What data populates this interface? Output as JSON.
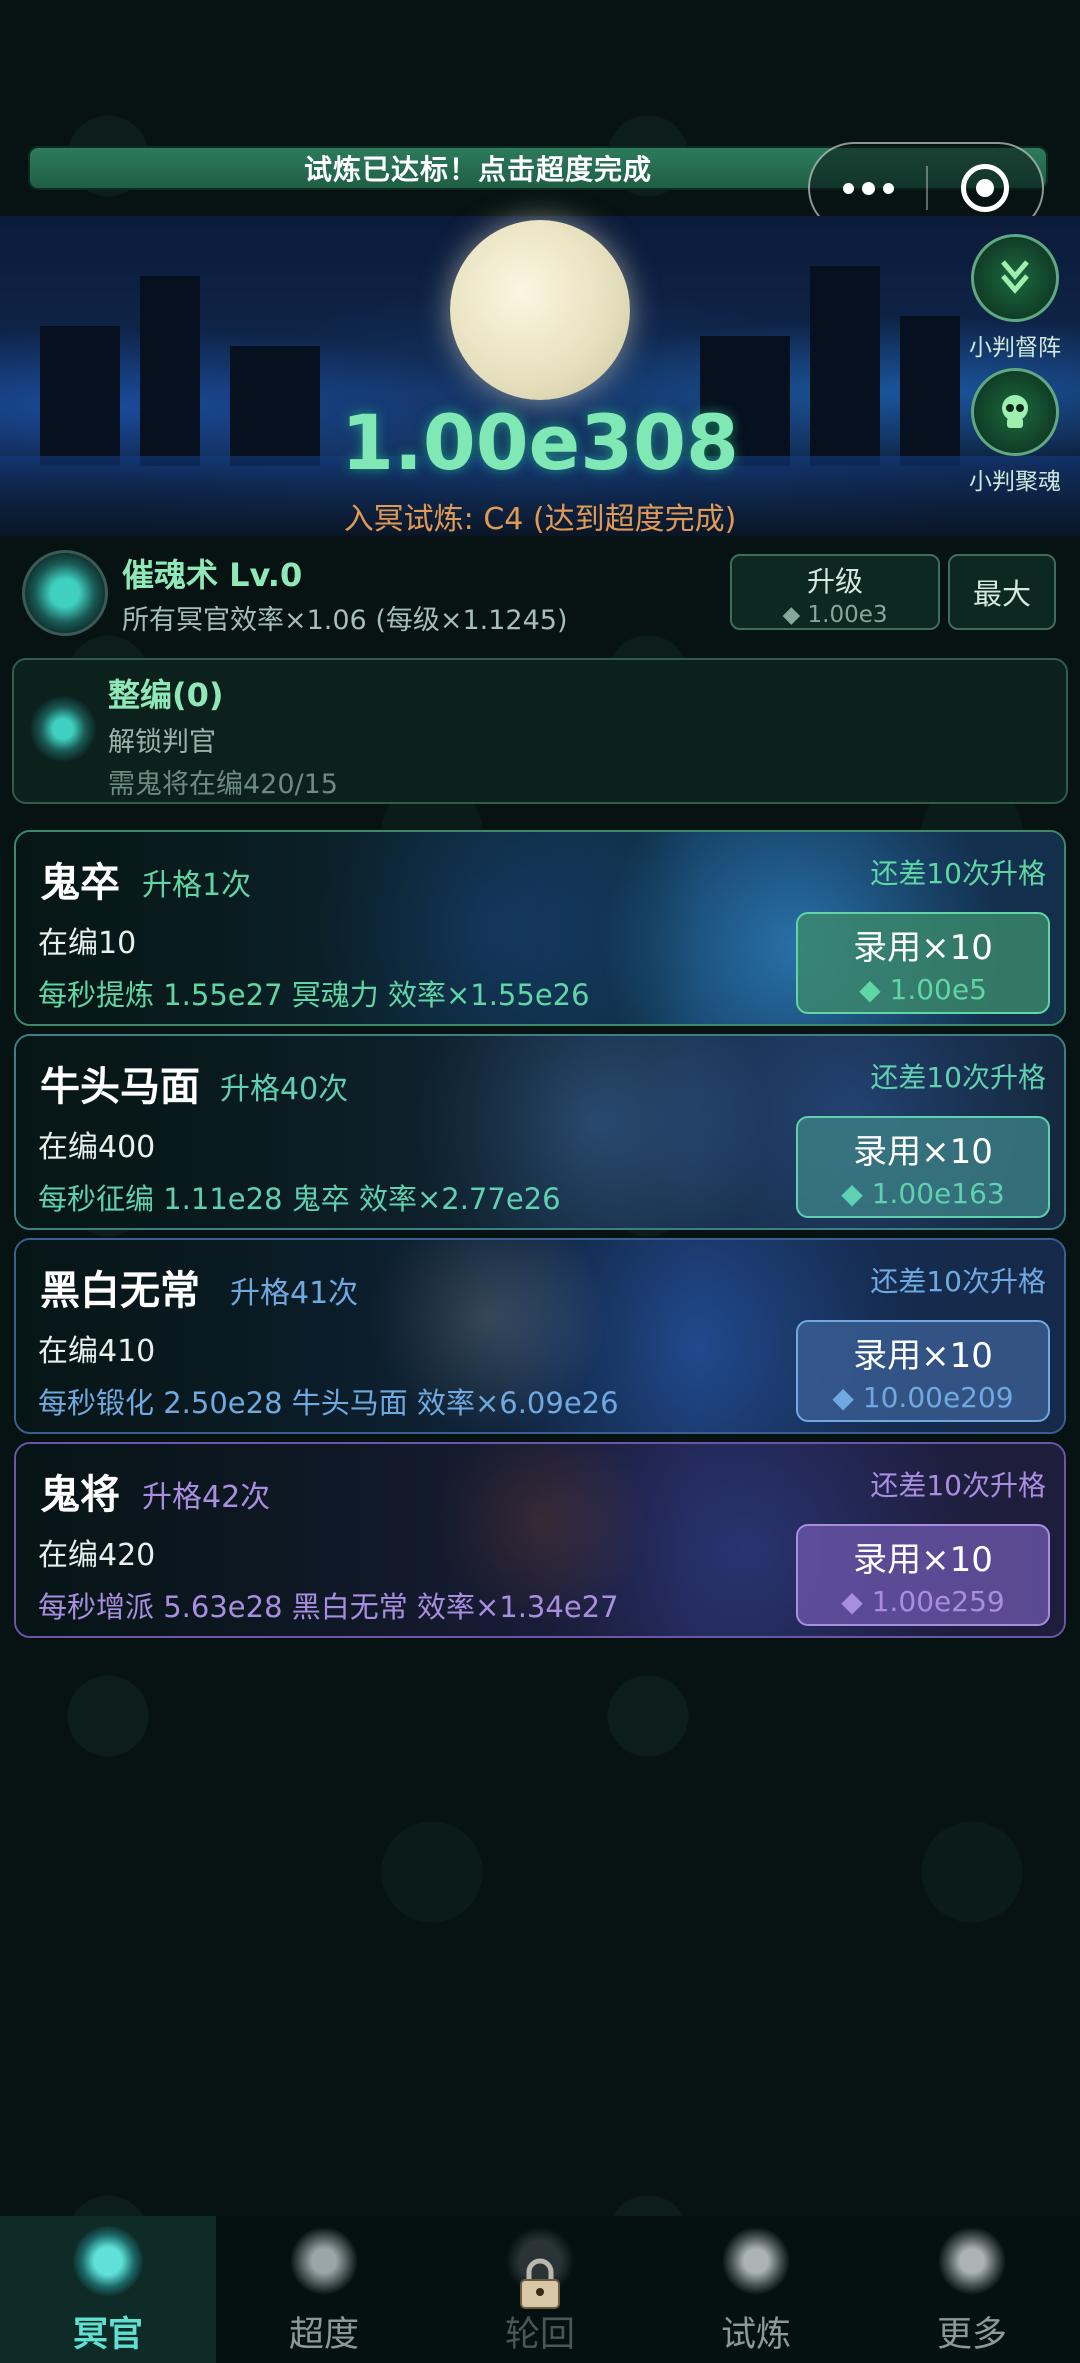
{
  "banner": {
    "text": "试炼已达标！点击超度完成"
  },
  "hero": {
    "score": "1.00e308",
    "trial": "入冥试炼: C4 (达到超度完成)"
  },
  "side_buttons": [
    {
      "label": "小判督阵",
      "icon": "formation-icon"
    },
    {
      "label": "小判聚魂",
      "icon": "skull-icon"
    }
  ],
  "skill": {
    "title": "催魂术 Lv.0",
    "desc": "所有冥官效率×1.06 (每级×1.1245)",
    "upgrade_label": "升级",
    "upgrade_cost": "◆ 1.00e3",
    "max_label": "最大"
  },
  "formation": {
    "title": "整编(0)",
    "line1": "解锁判官",
    "line2": "需鬼将在编420/15"
  },
  "units": [
    {
      "name": "鬼卒",
      "upgrades": "升格1次",
      "need": "还差10次升格",
      "count": "在编10",
      "prod": "每秒提炼 1.55e27 冥魂力  效率×1.55e26",
      "btn_label": "录用×10",
      "btn_cost": "◆ 1.00e5",
      "accent": "#5fd6a3",
      "border": "#3c8a6b"
    },
    {
      "name": "牛头马面",
      "upgrades": "升格40次",
      "need": "还差10次升格",
      "count": "在编400",
      "prod": "每秒征编 1.11e28 鬼卒  效率×2.77e26",
      "btn_label": "录用×10",
      "btn_cost": "◆ 1.00e163",
      "accent": "#5fd0b0",
      "border": "#3c7f86"
    },
    {
      "name": "黑白无常",
      "upgrades": "升格41次",
      "need": "还差10次升格",
      "count": "在编410",
      "prod": "每秒锻化 2.50e28 牛头马面  效率×6.09e26",
      "btn_label": "录用×10",
      "btn_cost": "◆ 10.00e209",
      "accent": "#6fa9e0",
      "border": "#3b5e93"
    },
    {
      "name": "鬼将",
      "upgrades": "升格42次",
      "need": "还差10次升格",
      "count": "在编420",
      "prod": "每秒增派 5.63e28 黑白无常  效率×1.34e27",
      "btn_label": "录用×10",
      "btn_cost": "◆ 1.00e259",
      "accent": "#a98ee0",
      "border": "#6a55a8"
    }
  ],
  "nav": [
    {
      "label": "冥官",
      "active": true,
      "icon": "skull-crest-icon"
    },
    {
      "label": "超度",
      "active": false,
      "icon": "demon-mask-icon"
    },
    {
      "label": "轮回",
      "active": false,
      "locked": true,
      "icon": "lock-icon"
    },
    {
      "label": "试炼",
      "active": false,
      "icon": "flame-emblem-icon"
    },
    {
      "label": "更多",
      "active": false,
      "icon": "spade-emblem-icon"
    }
  ]
}
